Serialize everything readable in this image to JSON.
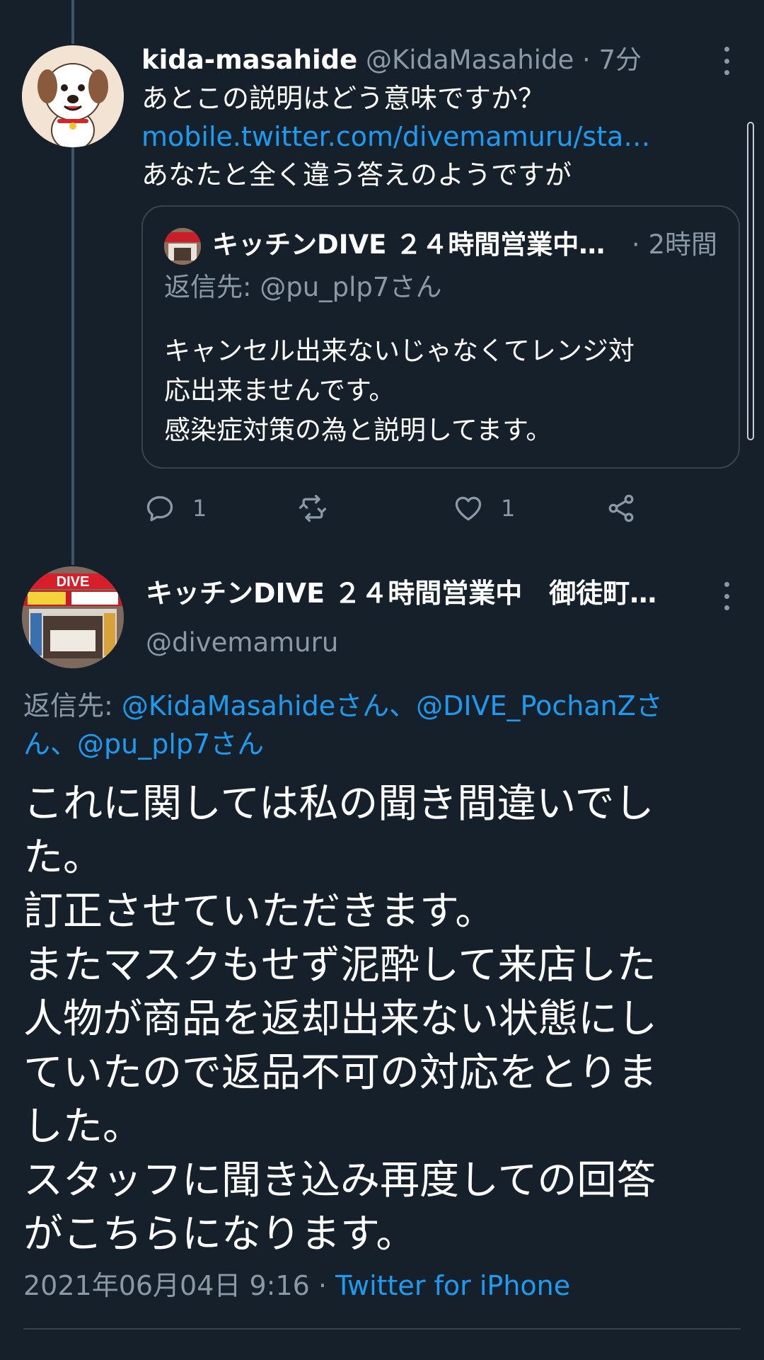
{
  "reply_tweet": {
    "author_name": "kida-masahide",
    "author_handle": "@KidaMasahide",
    "time": "· 7分",
    "lines": [
      "あとこの説明はどう意味ですか？",
      "mobile.twitter.com/divemamuru/sta…",
      "あなたと全く違う答えのようですが"
    ],
    "avatar_icon": "dog-avatar",
    "quote": {
      "author_name": "キッチンDIVE ２４時間営業中　御徒町…",
      "time": "· 2時間",
      "reply_to": "返信先: @pu_plp7さん",
      "lines": [
        "キャンセル出来ないじゃなくてレンジ対",
        "応出来ませんです。",
        "感染症対策の為と説明してます。"
      ]
    },
    "actions": {
      "reply_count": "1",
      "retweet_count": "",
      "like_count": "1"
    }
  },
  "main_tweet": {
    "author_name": "キッチンDIVE ２４時間営業中　御徒町…",
    "author_handle": "@divemamuru",
    "reply_prefix": "返信先: ",
    "reply_line1_links": "@KidaMasahideさん、@DIVE_PochanZさ",
    "reply_line2_links": "ん、@pu_plp7さん",
    "body_lines": [
      "これに関しては私の聞き間違いでし",
      "た。",
      "訂正させていただきます。",
      "またマスクもせず泥酔して来店した",
      "人物が商品を返却出来ない状態にし",
      "ていたので返品不可の対応をとりま",
      "した。",
      "スタッフに聞き込み再度しての回答",
      "がこちらになります。"
    ],
    "timestamp": "2021年06月04日 9:16 · ",
    "client": "Twitter for iPhone"
  },
  "colors": {
    "background": "#15202b",
    "link": "#1d9bf0",
    "muted": "#8b98a5",
    "border": "#38444d"
  }
}
